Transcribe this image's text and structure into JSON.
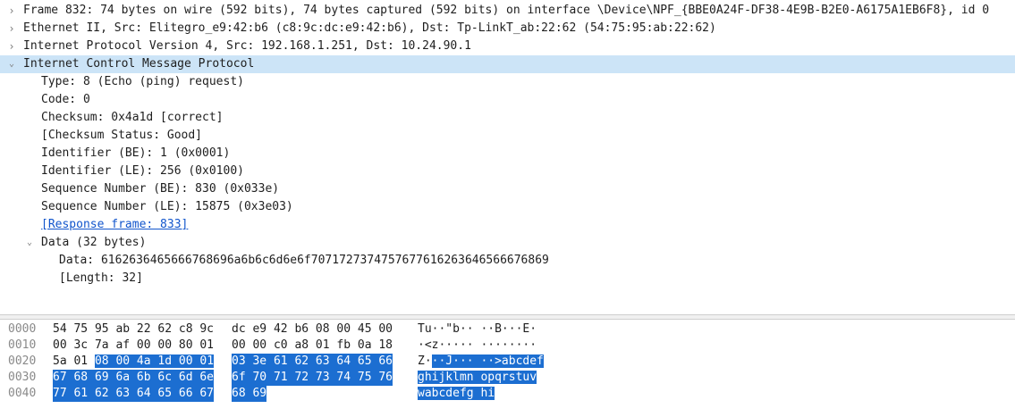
{
  "details": {
    "frame": "Frame 832: 74 bytes on wire (592 bits), 74 bytes captured (592 bits) on interface \\Device\\NPF_{BBE0A24F-DF38-4E9B-B2E0-A6175A1EB6F8}, id 0",
    "ethernet": "Ethernet II, Src: Elitegro_e9:42:b6 (c8:9c:dc:e9:42:b6), Dst: Tp-LinkT_ab:22:62 (54:75:95:ab:22:62)",
    "ipv4": "Internet Protocol Version 4, Src: 192.168.1.251, Dst: 10.24.90.1",
    "icmp": "Internet Control Message Protocol",
    "type": "Type: 8 (Echo (ping) request)",
    "code": "Code: 0",
    "checksum": "Checksum: 0x4a1d [correct]",
    "checksum_status": "[Checksum Status: Good]",
    "identifier_be": "Identifier (BE): 1 (0x0001)",
    "identifier_le": "Identifier (LE): 256 (0x0100)",
    "seq_be": "Sequence Number (BE): 830 (0x033e)",
    "seq_le": "Sequence Number (LE): 15875 (0x3e03)",
    "response_frame": "[Response frame: 833]",
    "data_node": "Data (32 bytes)",
    "data_value": "Data: 6162636465666768696a6b6c6d6e6f7071727374757677616263646566676869",
    "length": "[Length: 32]"
  },
  "toggle_glyphs": {
    "collapsed": "›",
    "expanded": "⌄"
  },
  "bytes": {
    "rows": [
      {
        "offset": "0000",
        "hex1": "54 75 95 ab 22 62 c8 9c",
        "hex2": "dc e9 42 b6 08 00 45 00",
        "ascii": "Tu··\"b·· ··B···E·"
      },
      {
        "offset": "0010",
        "hex1": "00 3c 7a af 00 00 80 01",
        "hex2": "00 00 c0 a8 01 fb 0a 18",
        "ascii": "·<z····· ········"
      },
      {
        "offset": "0020",
        "hex1_plain": "5a 01 ",
        "hex1_sel": "08 00 4a 1d 00 01",
        "hex2_sel": "03 3e 61 62 63 64 65 66",
        "ascii_plain": "Z·",
        "ascii_sel": "··J··· ··>abcdef"
      },
      {
        "offset": "0030",
        "hex1_sel": "67 68 69 6a 6b 6c 6d 6e",
        "hex2_sel": "6f 70 71 72 73 74 75 76",
        "ascii_sel": "ghijklmn opqrstuv"
      },
      {
        "offset": "0040",
        "hex1_sel": "77 61 62 63 64 65 66 67",
        "hex2_sel": "68 69",
        "ascii_sel": "wabcdefg hi"
      }
    ]
  },
  "colors": {
    "selected_row": "#cce4f7",
    "byte_highlight": "#1c6ed1",
    "link": "#1155cc"
  }
}
